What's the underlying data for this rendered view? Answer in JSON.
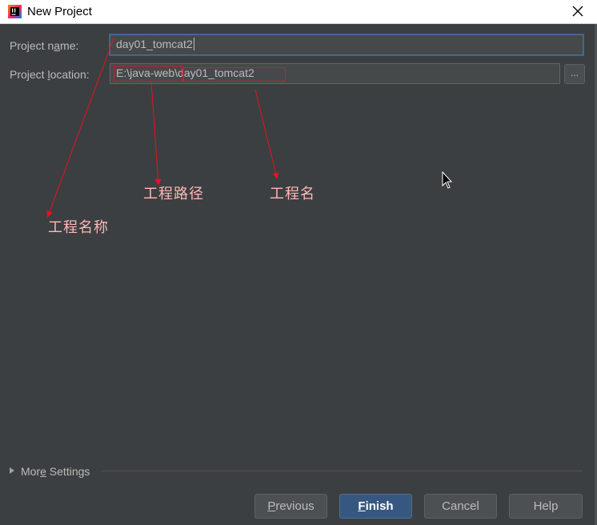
{
  "window": {
    "title": "New Project",
    "icon": "intellij-app-icon",
    "close_icon": "close-icon"
  },
  "form": {
    "project_name_label": {
      "pre": "Project n",
      "mn": "a",
      "post": "me:"
    },
    "project_name_value": "day01_tomcat2",
    "project_location_label": {
      "pre": "Project ",
      "mn": "l",
      "post": "ocation:"
    },
    "project_location_value": "E:\\java-web\\day01_tomcat2",
    "browse_label": "..."
  },
  "annotations": {
    "name_label": "工程名称",
    "path_label": "工程路径",
    "project_label": "工程名",
    "color": "#e81123"
  },
  "more_settings": {
    "pre": "Mor",
    "mn": "e",
    "post": " Settings"
  },
  "buttons": {
    "previous": {
      "mn": "P",
      "rest": "revious"
    },
    "finish": {
      "mn": "F",
      "rest": "inish"
    },
    "cancel": "Cancel",
    "help": "Help"
  },
  "colors": {
    "background": "#3c3f41",
    "primary_button": "#365880",
    "input_background": "#45494a"
  }
}
